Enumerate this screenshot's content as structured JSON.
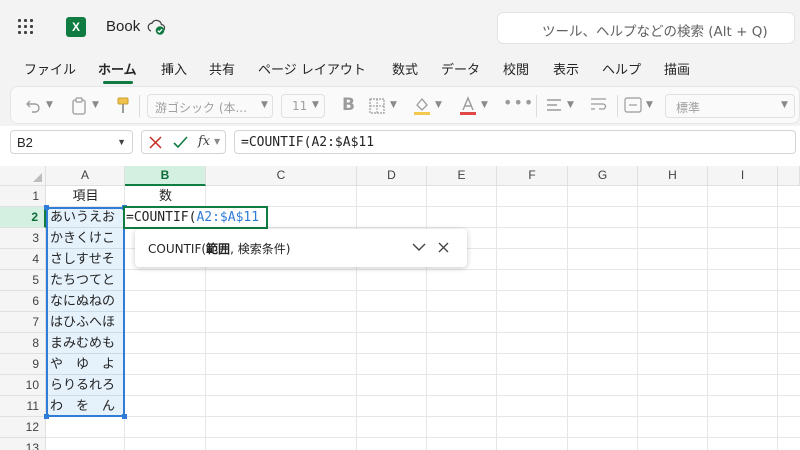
{
  "app": {
    "title": "Book",
    "logo_letter": "X",
    "search_placeholder": "ツール、ヘルプなどの検索 (Alt + Q)"
  },
  "ribbon": {
    "tabs": [
      "ファイル",
      "ホーム",
      "挿入",
      "共有",
      "ページ レイアウト",
      "数式",
      "データ",
      "校閲",
      "表示",
      "ヘルプ",
      "描画"
    ],
    "active_tab": "ホーム",
    "font_name": "游ゴシック (本...",
    "font_size": "11",
    "bold_label": "B",
    "number_format": "標準"
  },
  "formula_bar": {
    "name_box": "B2",
    "fx_label": "fx",
    "formula": "=COUNTIF(A2:$A$11"
  },
  "grid": {
    "columns": [
      "A",
      "B",
      "C",
      "D",
      "E",
      "F",
      "G",
      "H",
      "I"
    ],
    "selected_column": "B",
    "rows": [
      "1",
      "2",
      "3",
      "4",
      "5",
      "6",
      "7",
      "8",
      "9",
      "10",
      "11",
      "12",
      "13"
    ],
    "selected_row": "2",
    "cells": {
      "A1": "項目",
      "B1": "数",
      "A2": "あいうえお",
      "A3": "かきくけこ",
      "A4": "さしすせそ",
      "A5": "たちつてと",
      "A6": "なにぬねの",
      "A7": "はひふへほ",
      "A8": "まみむめも",
      "A9": "や　ゆ　よ",
      "A10": "らりるれろ",
      "A11": "わ　を　ん"
    },
    "edit_prefix": "=COUNTIF(",
    "edit_ref": "A2:$A$11"
  },
  "tooltip": {
    "function": "COUNTIF(",
    "arg1": "範囲",
    "rest": ", 検索条件)"
  },
  "colors": {
    "accent": "#107c41",
    "reference": "#2f7dd6",
    "delete": "#c42b1c"
  }
}
